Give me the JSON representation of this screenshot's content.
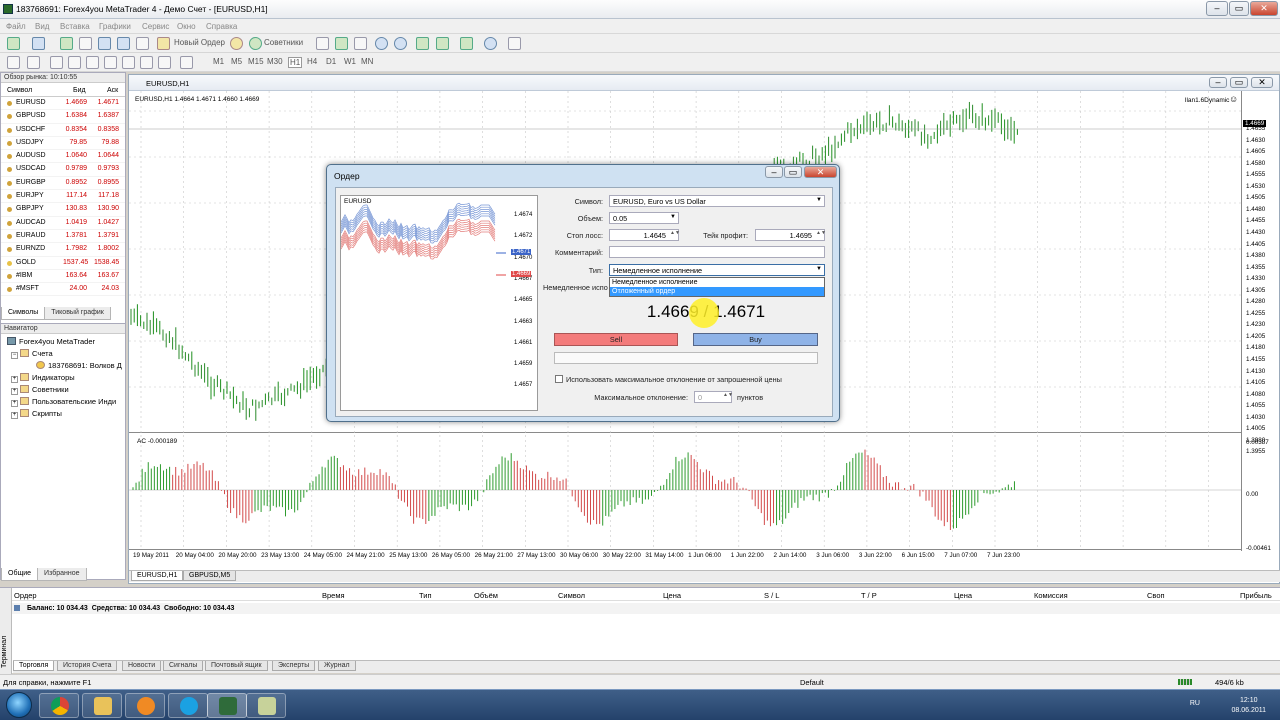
{
  "window": {
    "title": "183768691: Forex4you MetaTrader 4 - Демо Счет - [EURUSD,H1]"
  },
  "menu": [
    "Файл",
    "Вид",
    "Вставка",
    "Графики",
    "Сервис",
    "Окно",
    "Справка"
  ],
  "toolbar": {
    "new_order": "Новый Ордер",
    "experts": "Советники",
    "timeframes": [
      "M1",
      "M5",
      "M15",
      "M30",
      "H1",
      "H4",
      "D1",
      "W1",
      "MN"
    ]
  },
  "market_watch": {
    "title": "Обзор рынка: 10:10:55",
    "headers": {
      "symbol": "Символ",
      "bid": "Бид",
      "ask": "Аск"
    },
    "rows": [
      {
        "symbol": "EURUSD",
        "bid": "1.4669",
        "ask": "1.4671"
      },
      {
        "symbol": "GBPUSD",
        "bid": "1.6384",
        "ask": "1.6387"
      },
      {
        "symbol": "USDCHF",
        "bid": "0.8354",
        "ask": "0.8358"
      },
      {
        "symbol": "USDJPY",
        "bid": "79.85",
        "ask": "79.88"
      },
      {
        "symbol": "AUDUSD",
        "bid": "1.0640",
        "ask": "1.0644"
      },
      {
        "symbol": "USDCAD",
        "bid": "0.9789",
        "ask": "0.9793"
      },
      {
        "symbol": "EURGBP",
        "bid": "0.8952",
        "ask": "0.8955"
      },
      {
        "symbol": "EURJPY",
        "bid": "117.14",
        "ask": "117.18"
      },
      {
        "symbol": "GBPJPY",
        "bid": "130.83",
        "ask": "130.90"
      },
      {
        "symbol": "AUDCAD",
        "bid": "1.0419",
        "ask": "1.0427"
      },
      {
        "symbol": "EURAUD",
        "bid": "1.3781",
        "ask": "1.3791"
      },
      {
        "symbol": "EURNZD",
        "bid": "1.7982",
        "ask": "1.8002"
      },
      {
        "symbol": "GOLD",
        "bid": "1537.45",
        "ask": "1538.45"
      },
      {
        "symbol": "#IBM",
        "bid": "163.64",
        "ask": "163.67"
      },
      {
        "symbol": "#MSFT",
        "bid": "24.00",
        "ask": "24.03"
      }
    ],
    "tabs": [
      "Символы",
      "Тиковый график"
    ]
  },
  "navigator": {
    "title": "Навигатор",
    "root": "Forex4you MetaTrader",
    "accounts": "Счета",
    "account": "183768691: Волков Д",
    "indicators": "Индикаторы",
    "experts": "Советники",
    "custom": "Пользовательские Инди",
    "scripts": "Скрипты",
    "tabs": [
      "Общие",
      "Избранное"
    ]
  },
  "chart": {
    "window_title": "EURUSD,H1",
    "info": "EURUSD,H1  1.4664 1.4671 1.4660 1.4669",
    "ea_label": "llan1.6Dynamic",
    "smiley": "☺",
    "current_price": "1.4669",
    "price_ticks": [
      "1.4655",
      "1.4630",
      "1.4605",
      "1.4580",
      "1.4555",
      "1.4530",
      "1.4505",
      "1.4480",
      "1.4455",
      "1.4430",
      "1.4405",
      "1.4380",
      "1.4355",
      "1.4330",
      "1.4305",
      "1.4280",
      "1.4255",
      "1.4230",
      "1.4205",
      "1.4180",
      "1.4155",
      "1.4130",
      "1.4105",
      "1.4080",
      "1.4055",
      "1.4030",
      "1.4005",
      "1.3980",
      "1.3955"
    ],
    "ac_label": "AC -0.000189",
    "ac_ticks": [
      "0.00387",
      "0.00",
      "-0.00461"
    ],
    "time_ticks": [
      "19 May 2011",
      "20 May 04:00",
      "20 May 20:00",
      "23 May 13:00",
      "24 May 05:00",
      "24 May 21:00",
      "25 May 13:00",
      "26 May 05:00",
      "26 May 21:00",
      "27 May 13:00",
      "30 May 06:00",
      "30 May 22:00",
      "31 May 14:00",
      "1 Jun 06:00",
      "1 Jun 22:00",
      "2 Jun 14:00",
      "3 Jun 06:00",
      "3 Jun 22:00",
      "6 Jun 15:00",
      "7 Jun 07:00",
      "7 Jun 23:00"
    ],
    "tabs": [
      "EURUSD,H1",
      "GBPUSD,M5"
    ]
  },
  "order_dialog": {
    "title": "Ордер",
    "mini_chart_label": "EURUSD",
    "mini_ticks": [
      "1.4674",
      "1.4672",
      "1.4670",
      "1.4667",
      "1.4665",
      "1.4663",
      "1.4661",
      "1.4659",
      "1.4657"
    ],
    "mini_ask": "1.4671",
    "mini_bid": "1.4669",
    "symbol_label": "Символ:",
    "symbol_value": "EURUSD, Euro vs US Dollar",
    "volume_label": "Объем:",
    "volume_value": "0.05",
    "sl_label": "Стоп лосс:",
    "sl_value": "1.4645",
    "tp_label": "Тейк профит:",
    "tp_value": "1.4695",
    "comment_label": "Комментарий:",
    "type_label": "Тип:",
    "type_value": "Немедленное исполнение",
    "type_options": [
      "Немедленное исполнение",
      "Отложенный ордер"
    ],
    "instant_label": "Немедленное испо",
    "quote_bid": "1.4669",
    "quote_sep": "/",
    "quote_ask": "1.4671",
    "sell": "Sell",
    "buy": "Buy",
    "deviation_check": "Использовать максимальное отклонение от запрошенной цены",
    "max_dev_label": "Максимальное отклонение:",
    "max_dev_value": "0",
    "points": "пунктов"
  },
  "terminal": {
    "side_label": "Терминал",
    "headers": [
      "Ордер",
      "Время",
      "Тип",
      "Объём",
      "Символ",
      "Цена",
      "S / L",
      "T / P",
      "Цена",
      "Комиссия",
      "Своп",
      "Прибыль"
    ],
    "balance_line": "Баланс: 10 034.43  Средства: 10 034.43  Свободно: 10 034.43",
    "tabs": [
      "Торговля",
      "История Счета",
      "Новости",
      "Сигналы",
      "Почтовый ящик",
      "Эксперты",
      "Журнал"
    ]
  },
  "status": {
    "help": "Для справки, нажмите F1",
    "profile": "Default",
    "traffic": "494/6 kb"
  },
  "taskbar": {
    "lang": "RU",
    "time": "12:10",
    "date": "08.06.2011"
  },
  "colors": {
    "buy": "#8fb3e7",
    "sell": "#f37b7b",
    "price_line": "#2e7d32",
    "up_bar": "#3aa53a",
    "down_bar": "#d54a4a"
  }
}
